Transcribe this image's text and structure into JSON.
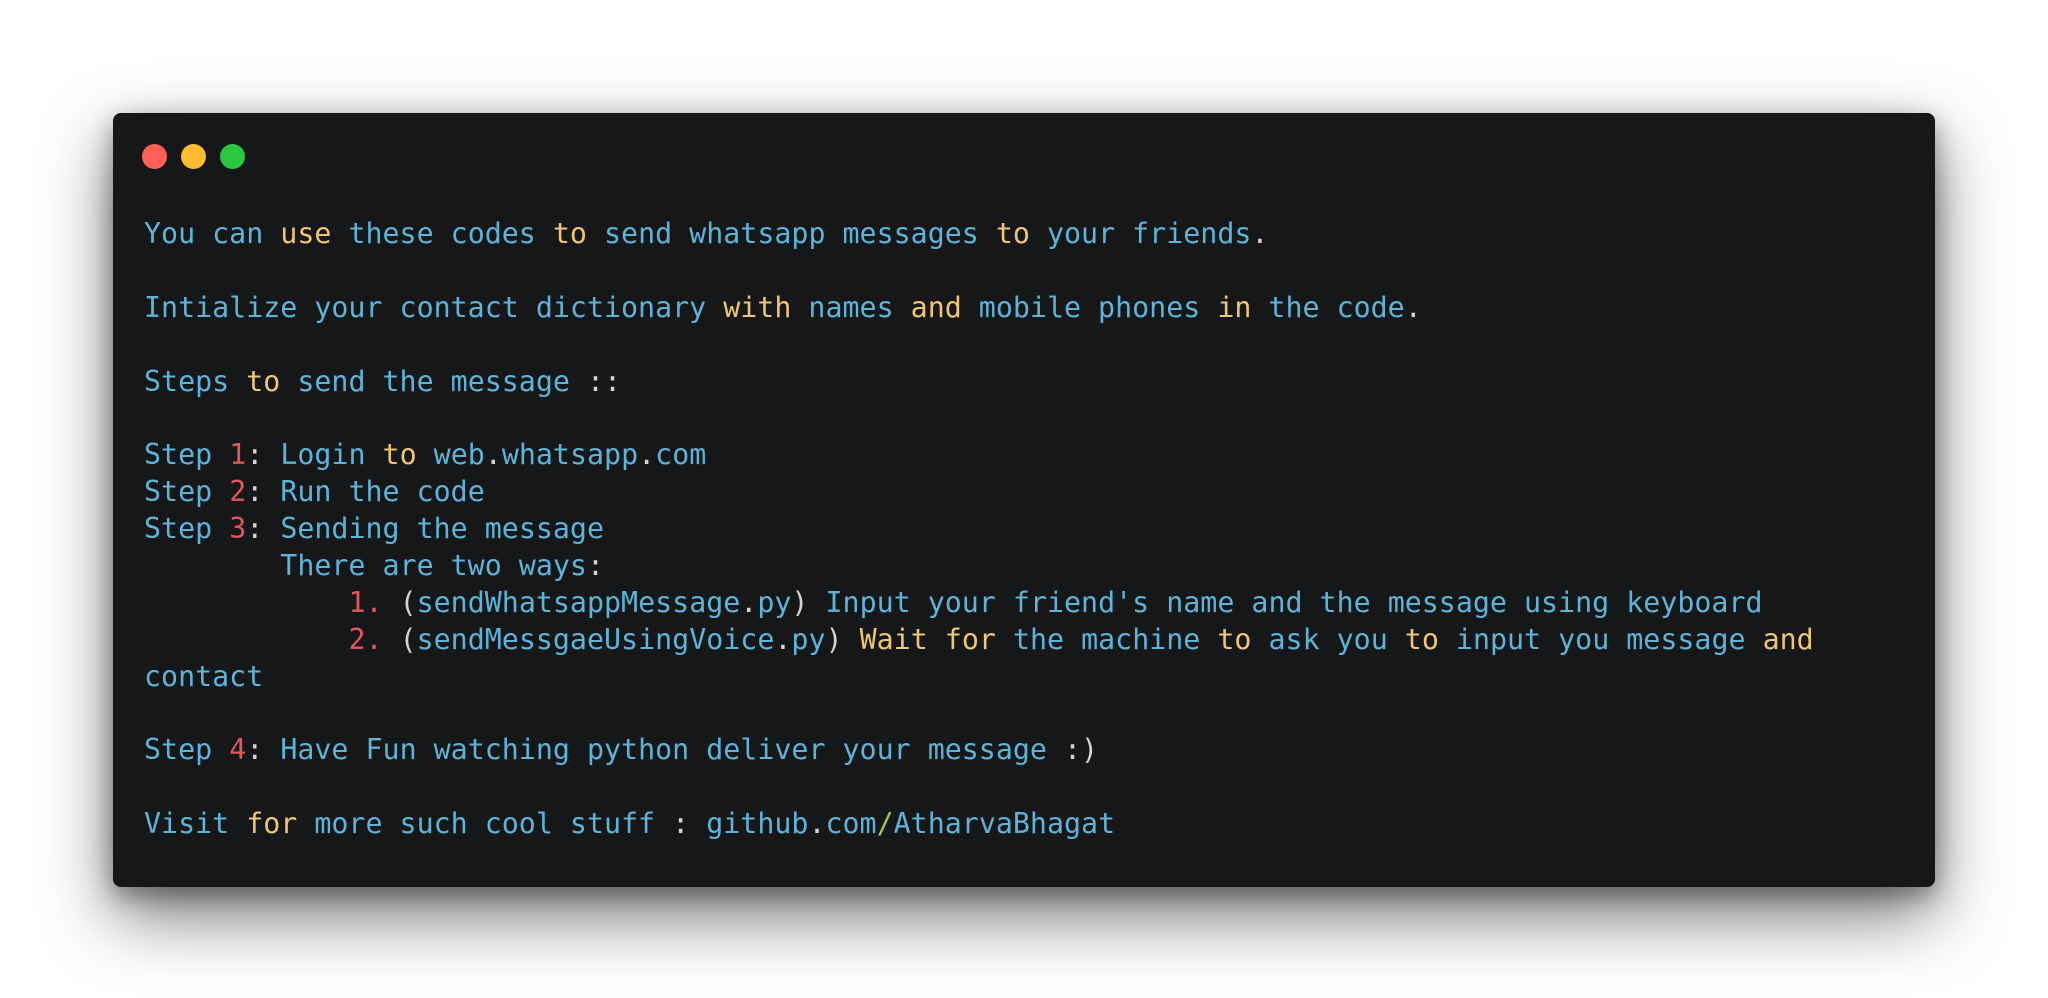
{
  "window": {
    "buttons": [
      {
        "name": "close",
        "color": "#ff5f57"
      },
      {
        "name": "minimize",
        "color": "#febc2e"
      },
      {
        "name": "zoom",
        "color": "#28c840"
      }
    ]
  },
  "colors": {
    "background": "#161719",
    "plain": "#5eb4d8",
    "keyword": "#f0c674",
    "number": "#e2555d",
    "operator": "#d4d4d4",
    "slash": "#9fc25d"
  },
  "lines": [
    [
      [
        "p",
        "You can "
      ],
      [
        "k",
        "use"
      ],
      [
        "p",
        " these codes "
      ],
      [
        "k",
        "to"
      ],
      [
        "p",
        " send whatsapp messages "
      ],
      [
        "k",
        "to"
      ],
      [
        "p",
        " your friends"
      ],
      [
        "o",
        "."
      ]
    ],
    [],
    [
      [
        "p",
        "Intialize your contact dictionary "
      ],
      [
        "k",
        "with"
      ],
      [
        "p",
        " names "
      ],
      [
        "k",
        "and"
      ],
      [
        "p",
        " mobile phones "
      ],
      [
        "k",
        "in"
      ],
      [
        "p",
        " the code"
      ],
      [
        "o",
        "."
      ]
    ],
    [],
    [
      [
        "p",
        "Steps "
      ],
      [
        "k",
        "to"
      ],
      [
        "p",
        " send the message "
      ],
      [
        "o",
        "::"
      ]
    ],
    [],
    [
      [
        "p",
        "Step "
      ],
      [
        "n",
        "1"
      ],
      [
        "o",
        ":"
      ],
      [
        "p",
        " Login "
      ],
      [
        "k",
        "to"
      ],
      [
        "p",
        " web"
      ],
      [
        "o",
        "."
      ],
      [
        "p",
        "whatsapp"
      ],
      [
        "o",
        "."
      ],
      [
        "p",
        "com"
      ]
    ],
    [
      [
        "p",
        "Step "
      ],
      [
        "n",
        "2"
      ],
      [
        "o",
        ":"
      ],
      [
        "p",
        " Run the code"
      ]
    ],
    [
      [
        "p",
        "Step "
      ],
      [
        "n",
        "3"
      ],
      [
        "o",
        ":"
      ],
      [
        "p",
        " Sending the message"
      ]
    ],
    [
      [
        "p",
        "        There are two ways"
      ],
      [
        "o",
        ":"
      ]
    ],
    [
      [
        "p",
        "            "
      ],
      [
        "n",
        "1."
      ],
      [
        "p",
        " "
      ],
      [
        "o",
        "("
      ],
      [
        "p",
        "sendWhatsappMessage"
      ],
      [
        "o",
        "."
      ],
      [
        "p",
        "py"
      ],
      [
        "o",
        ")"
      ],
      [
        "p",
        " Input your friend's name and the message using keyboard"
      ]
    ],
    [
      [
        "p",
        "            "
      ],
      [
        "n",
        "2."
      ],
      [
        "p",
        " "
      ],
      [
        "o",
        "("
      ],
      [
        "p",
        "sendMessgaeUsingVoice"
      ],
      [
        "o",
        "."
      ],
      [
        "p",
        "py"
      ],
      [
        "o",
        ")"
      ],
      [
        "p",
        " "
      ],
      [
        "k",
        "Wait"
      ],
      [
        "p",
        " "
      ],
      [
        "k",
        "for"
      ],
      [
        "p",
        " the machine "
      ],
      [
        "k",
        "to"
      ],
      [
        "p",
        " ask you "
      ],
      [
        "k",
        "to"
      ],
      [
        "p",
        " input you message "
      ],
      [
        "k",
        "and"
      ]
    ],
    [
      [
        "p",
        "contact"
      ]
    ],
    [],
    [
      [
        "p",
        "Step "
      ],
      [
        "n",
        "4"
      ],
      [
        "o",
        ":"
      ],
      [
        "p",
        " Have Fun watching python deliver your message "
      ],
      [
        "o",
        ":)"
      ]
    ],
    [],
    [
      [
        "p",
        "Visit "
      ],
      [
        "k",
        "for"
      ],
      [
        "p",
        " more such cool stuff "
      ],
      [
        "o",
        ":"
      ],
      [
        "p",
        " github"
      ],
      [
        "o",
        "."
      ],
      [
        "p",
        "com"
      ],
      [
        "g",
        "/"
      ],
      [
        "p",
        "AtharvaBhagat"
      ]
    ]
  ]
}
